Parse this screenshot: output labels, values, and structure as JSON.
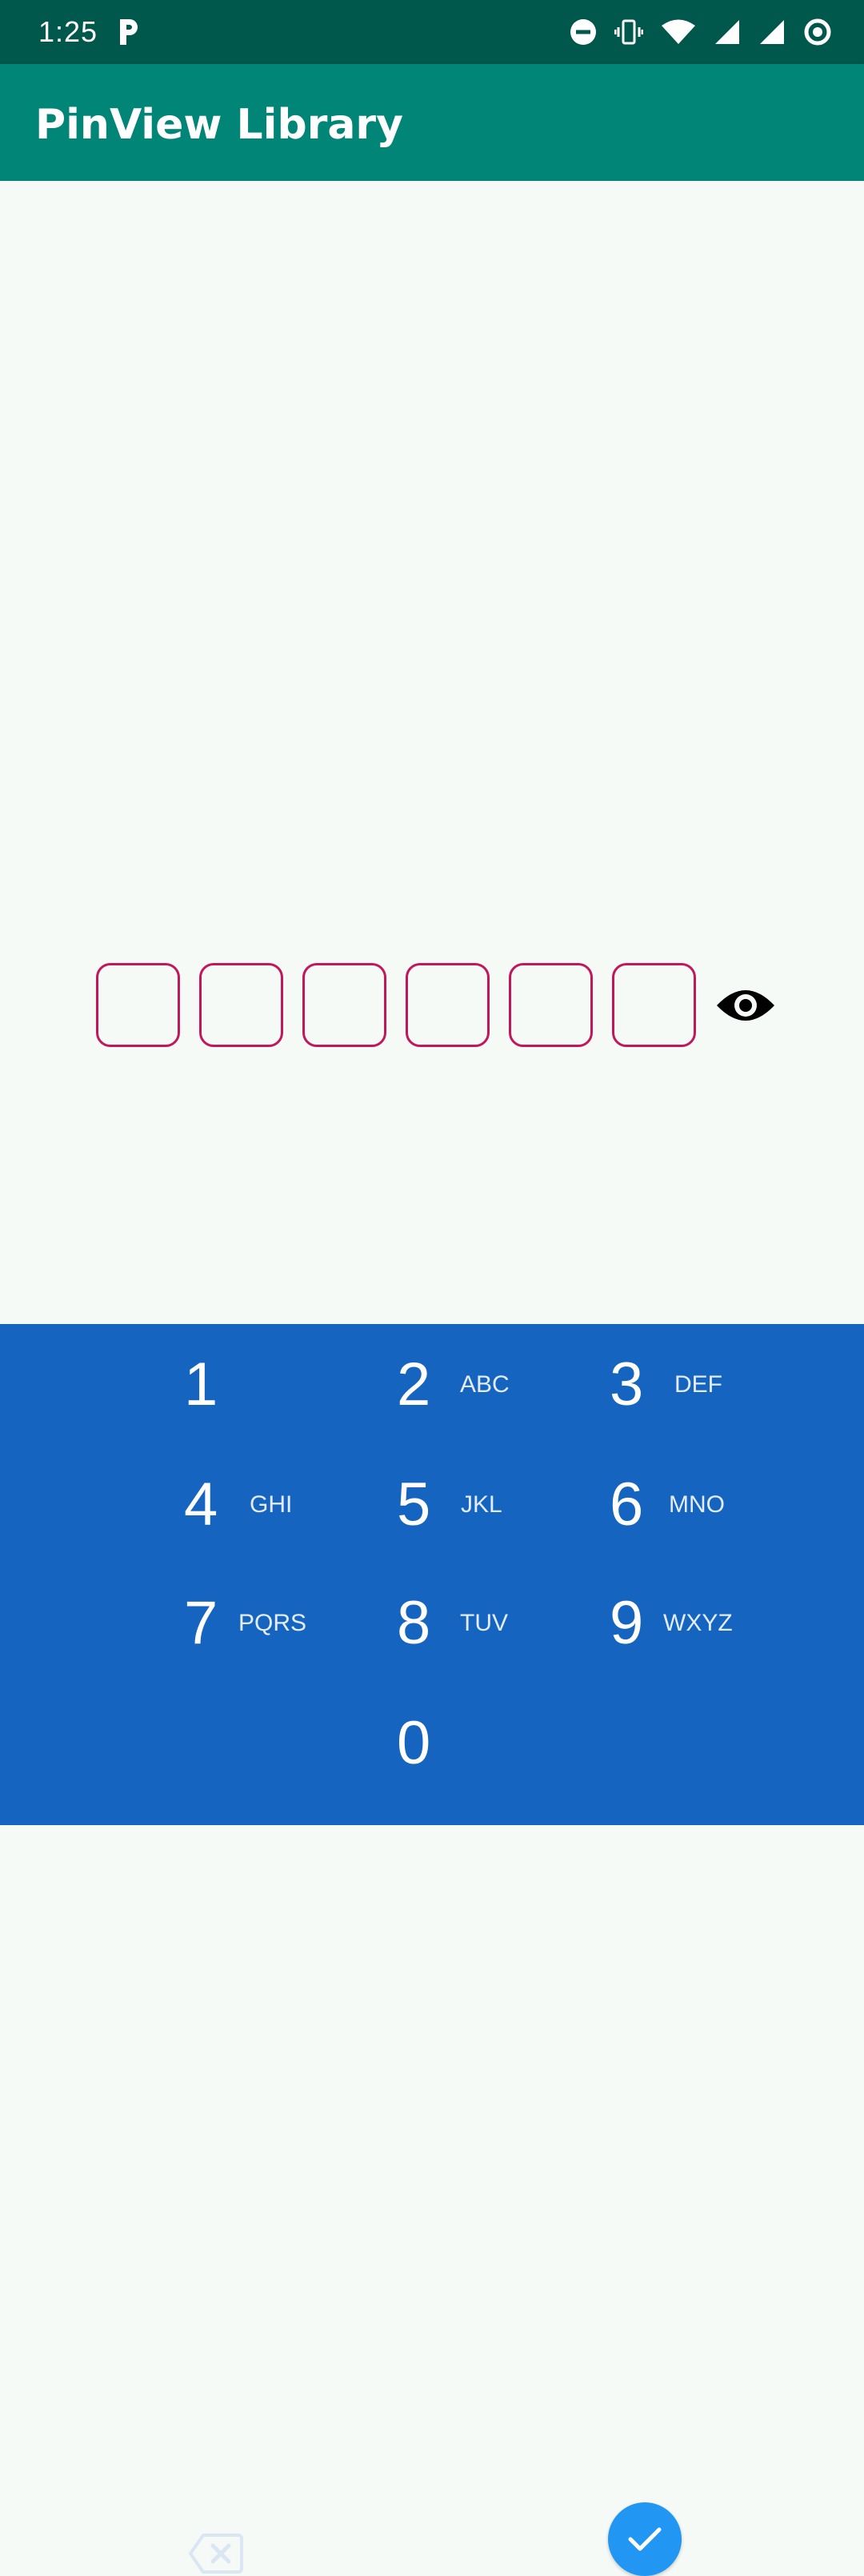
{
  "status_bar": {
    "time": "1:25",
    "icons": [
      "parking-notification-icon",
      "do-not-disturb-icon",
      "vibrate-icon",
      "wifi-icon",
      "signal-icon",
      "signal-icon-2",
      "sync-icon"
    ]
  },
  "app_bar": {
    "title": "PinView Library"
  },
  "pin_view": {
    "length": 6,
    "values": [
      "",
      "",
      "",
      "",
      "",
      ""
    ],
    "border_color": "#c2185b",
    "toggle_icon": "eye-icon"
  },
  "keypad": {
    "background": "#1565c0",
    "keys": [
      {
        "digit": "1",
        "letters": ""
      },
      {
        "digit": "2",
        "letters": "ABC"
      },
      {
        "digit": "3",
        "letters": "DEF"
      },
      {
        "digit": "4",
        "letters": "GHI"
      },
      {
        "digit": "5",
        "letters": "JKL"
      },
      {
        "digit": "6",
        "letters": "MNO"
      },
      {
        "digit": "7",
        "letters": "PQRS"
      },
      {
        "digit": "8",
        "letters": "TUV"
      },
      {
        "digit": "9",
        "letters": "WXYZ"
      },
      {
        "digit": "0",
        "letters": ""
      }
    ],
    "backspace_icon": "backspace-icon",
    "done_icon": "check-icon",
    "done_color": "#2196f3"
  },
  "colors": {
    "status_bar": "#00574b",
    "app_bar": "#008577",
    "content_bg": "#f5faf6"
  }
}
